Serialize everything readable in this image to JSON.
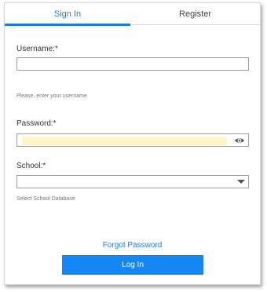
{
  "tabs": [
    {
      "label": "Sign In",
      "active": true
    },
    {
      "label": "Register",
      "active": false
    }
  ],
  "form": {
    "username": {
      "label": "Username:*",
      "value": "",
      "help": "Please, enter your username"
    },
    "password": {
      "label": "Password:*",
      "value": "",
      "toggle_icon": "eye-icon"
    },
    "school": {
      "label": "School:*",
      "selected": "",
      "help": "Select School Database",
      "dropdown_icon": "caret-down-icon"
    }
  },
  "links": {
    "forgot_password": "Forgot Password"
  },
  "buttons": {
    "login": "Log In"
  },
  "colors": {
    "accent": "#1b7fd4",
    "button": "#1587f5",
    "autofill": "#fbf5c9"
  }
}
